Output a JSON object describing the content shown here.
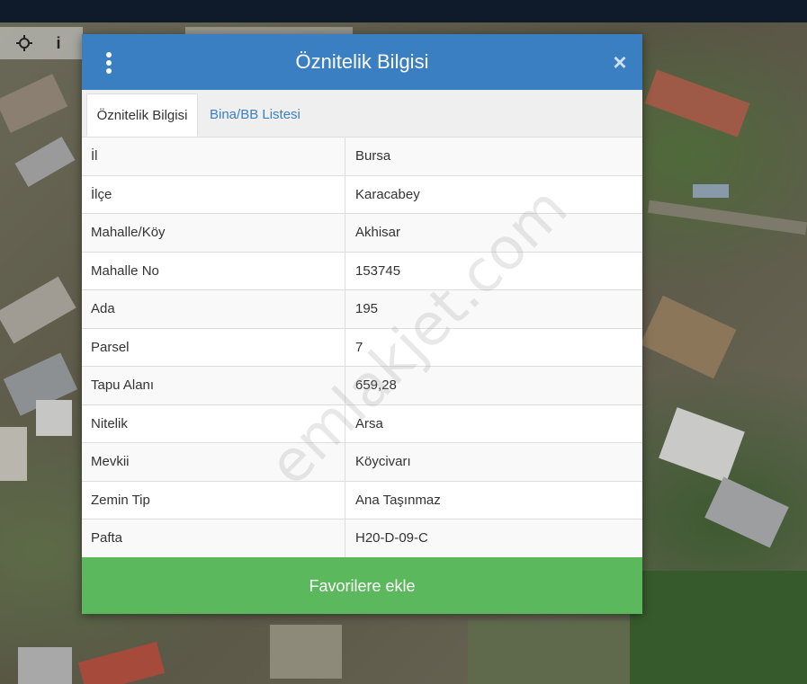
{
  "toolbar": {
    "move_icon": "move-icon",
    "info_icon": "info-icon",
    "info_glyph": "i"
  },
  "dialog": {
    "title": "Öznitelik Bilgisi",
    "tabs": [
      {
        "label": "Öznitelik Bilgisi",
        "active": true
      },
      {
        "label": "Bina/BB Listesi",
        "active": false
      }
    ],
    "rows": [
      {
        "label": "İl",
        "value": "Bursa"
      },
      {
        "label": "İlçe",
        "value": "Karacabey"
      },
      {
        "label": "Mahalle/Köy",
        "value": "Akhisar"
      },
      {
        "label": "Mahalle No",
        "value": "153745"
      },
      {
        "label": "Ada",
        "value": "195"
      },
      {
        "label": "Parsel",
        "value": "7"
      },
      {
        "label": "Tapu Alanı",
        "value": "659,28"
      },
      {
        "label": "Nitelik",
        "value": "Arsa"
      },
      {
        "label": "Mevkii",
        "value": "Köycivarı"
      },
      {
        "label": "Zemin Tip",
        "value": "Ana Taşınmaz"
      },
      {
        "label": "Pafta",
        "value": "H20-D-09-C"
      }
    ],
    "favorite_button": "Favorilere ekle",
    "close_symbol": "×"
  },
  "watermark": "emlakjet.com",
  "colors": {
    "header": "#3a7fc1",
    "button": "#5cb85c",
    "topbar": "#0f1b2a"
  }
}
